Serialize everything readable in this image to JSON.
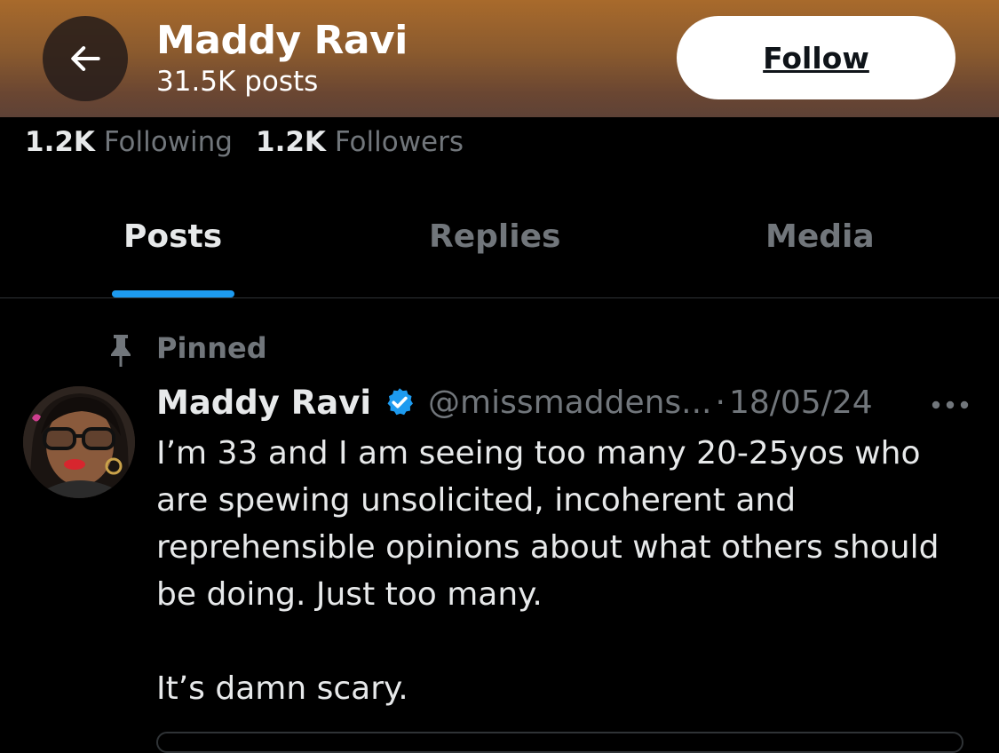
{
  "header": {
    "name": "Maddy Ravi",
    "posts_count": "31.5K posts",
    "follow_label": "Follow"
  },
  "stats": {
    "following_count": "1.2K",
    "following_label": "Following",
    "followers_count": "1.2K",
    "followers_label": "Followers"
  },
  "tabs": [
    {
      "label": "Posts",
      "active": true
    },
    {
      "label": "Replies",
      "active": false
    },
    {
      "label": "Media",
      "active": false
    }
  ],
  "post": {
    "pinned_label": "Pinned",
    "author_name": "Maddy Ravi",
    "handle": "@missmaddens...",
    "separator": "·",
    "date": "18/05/24",
    "text": "I’m 33 and I am seeing too many 20-25yos who are spewing unsolicited, incoherent and reprehensible opinions about what others should be doing. Just too many.\n\nIt’s damn scary."
  },
  "icons": {
    "back": "arrow-left-icon",
    "pin": "pin-icon",
    "verified": "verified-badge-icon",
    "more": "more-horizontal-icon"
  },
  "colors": {
    "accent": "#1d9bf0",
    "muted_text": "#71767b",
    "background": "#000000"
  }
}
